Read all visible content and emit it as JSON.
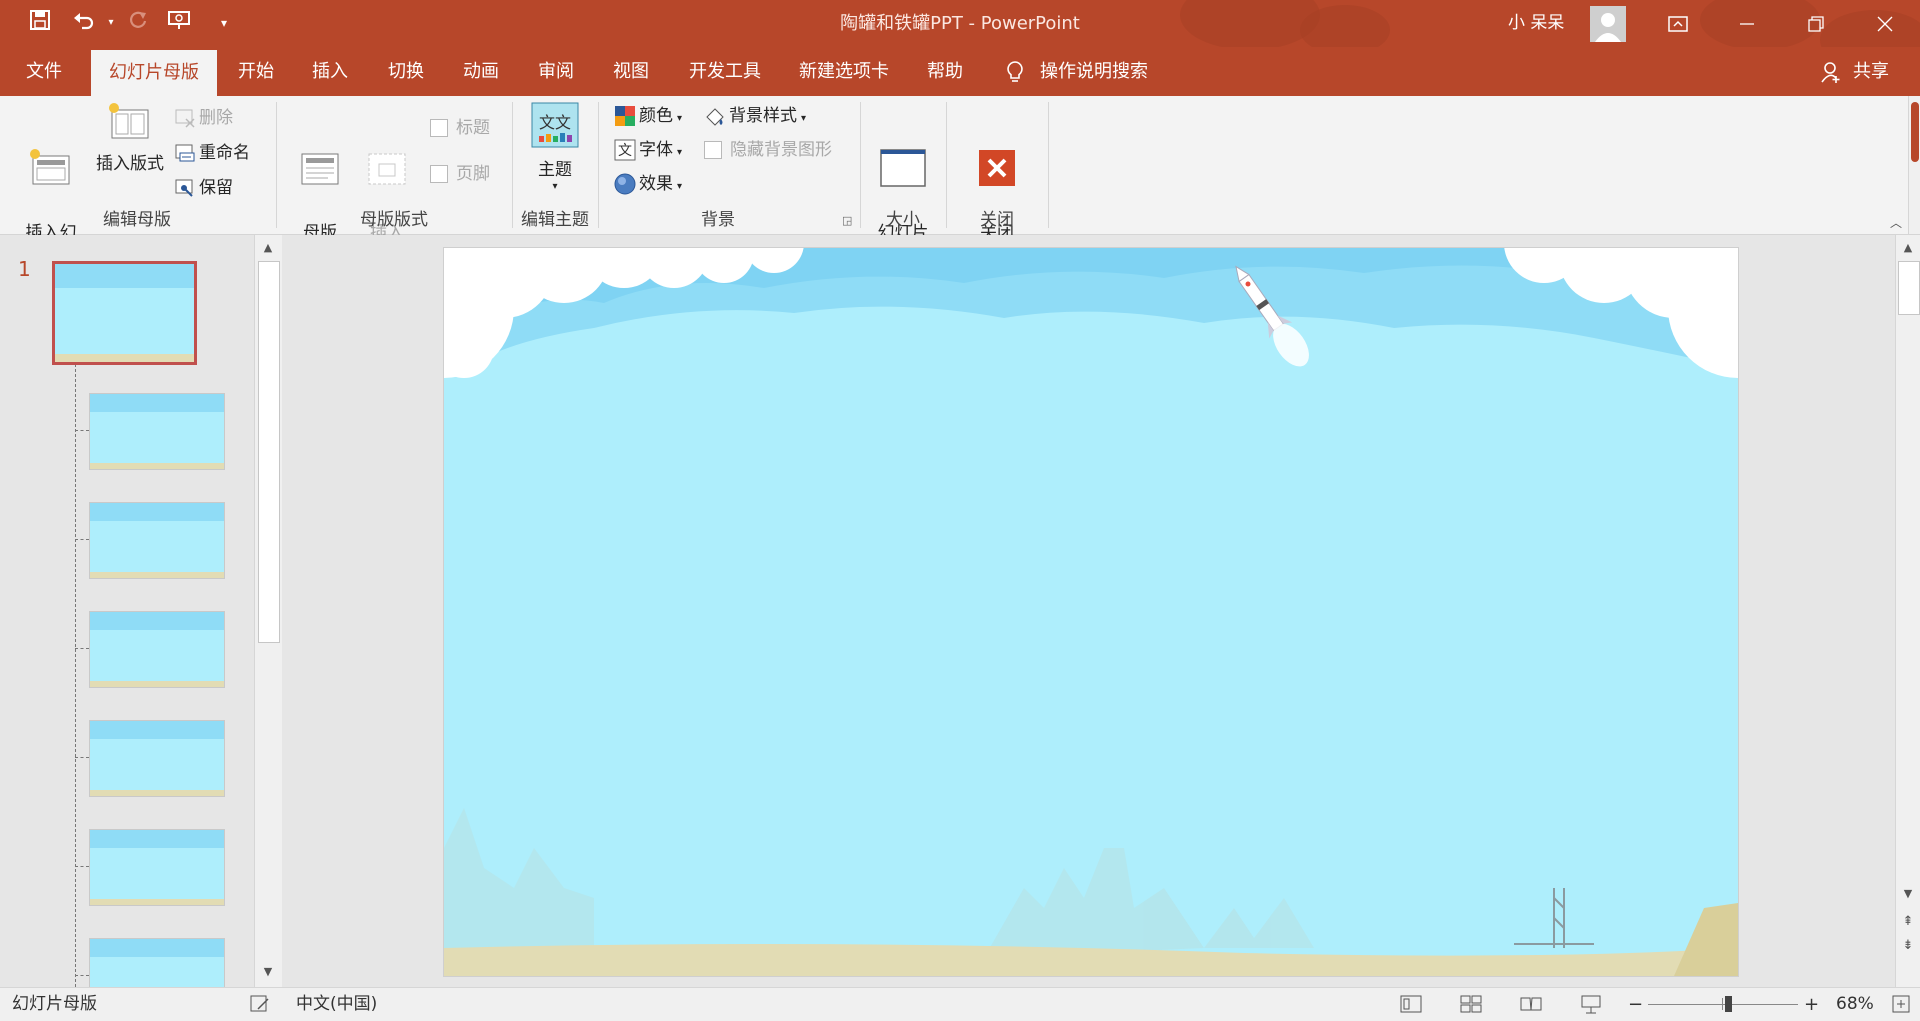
{
  "window": {
    "title": "陶罐和铁罐PPT  -  PowerPoint",
    "user_name": "小 呆呆",
    "share_label": "共享",
    "accent_color": "#b7472a"
  },
  "quick_access": {
    "icons": [
      "save-icon",
      "undo-icon",
      "redo-icon",
      "present-from-start-icon",
      "customize-dropdown-icon"
    ]
  },
  "tabs": [
    {
      "label": "文件"
    },
    {
      "label": "幻灯片母版",
      "active": true
    },
    {
      "label": "开始"
    },
    {
      "label": "插入"
    },
    {
      "label": "切换"
    },
    {
      "label": "动画"
    },
    {
      "label": "审阅"
    },
    {
      "label": "视图"
    },
    {
      "label": "开发工具"
    },
    {
      "label": "新建选项卡"
    },
    {
      "label": "帮助"
    }
  ],
  "tell_me": "操作说明搜索",
  "ribbon": {
    "edit_master": {
      "label": "编辑母版",
      "insert_slide_master": "插入幻\n灯片母版",
      "insert_layout": "插入版式",
      "delete": "删除",
      "rename": "重命名",
      "preserve": "保留"
    },
    "master_layout": {
      "label": "母版版式",
      "master_layout_btn": "母版\n版式",
      "insert_placeholder": "插入\n占位符",
      "title_check": "标题",
      "footer_check": "页脚"
    },
    "edit_theme": {
      "label": "编辑主题",
      "themes": "主题"
    },
    "background": {
      "label": "背景",
      "colors": "颜色",
      "fonts": "字体",
      "effects": "效果",
      "background_styles": "背景样式",
      "hide_bg_graphics": "隐藏背景图形"
    },
    "size": {
      "label": "大小",
      "slide_size": "幻灯片\n大小"
    },
    "close": {
      "label": "关闭",
      "close_master_view": "关闭\n母版视图"
    }
  },
  "thumbnails": {
    "master_number": "1",
    "layout_count": 7
  },
  "status": {
    "view_name": "幻灯片母版",
    "language": "中文(中国)",
    "zoom": "68%",
    "zoom_fraction": 0.53
  }
}
